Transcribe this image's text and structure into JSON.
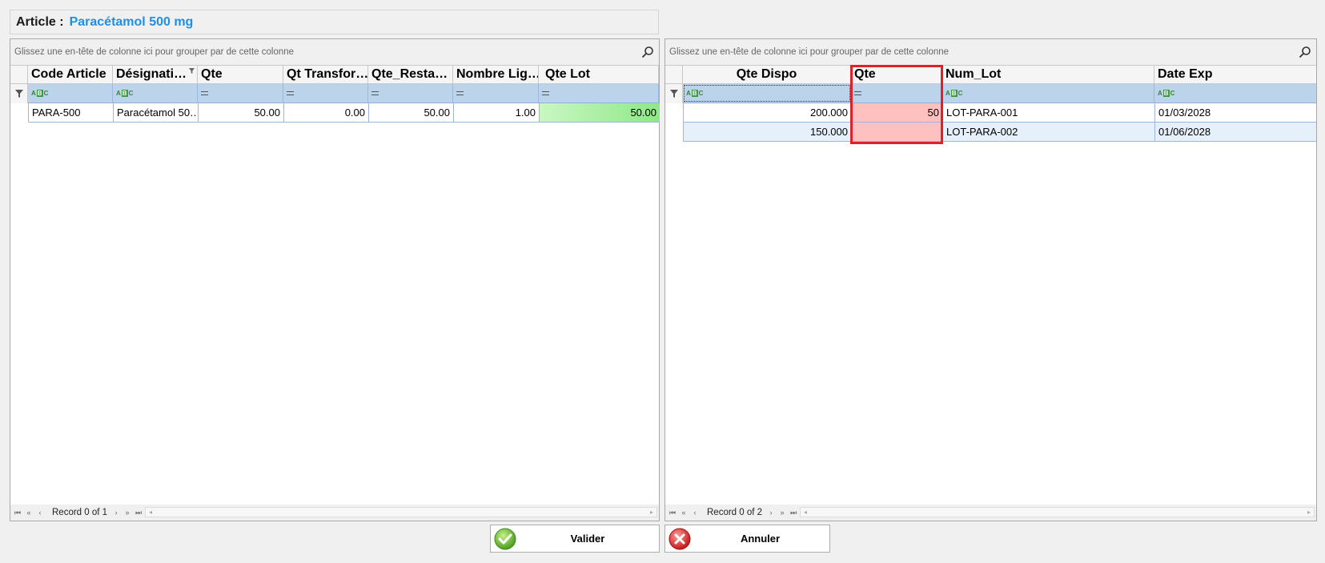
{
  "article": {
    "label": "Article :",
    "value": "Paracétamol 500 mg"
  },
  "group_hint": "Glissez une en-tête de colonne ici pour grouper par de cette colonne",
  "left_grid": {
    "columns": [
      "Code Article",
      "Désignati…",
      "Qte",
      "Qt Transfor…",
      "Qte_Resta…",
      "Nombre Lig…",
      "Qte Lot"
    ],
    "rows": [
      {
        "code": "PARA-500",
        "designation": "Paracétamol 50…",
        "qte": "50.00",
        "qt_transfor": "0.00",
        "qte_resta": "50.00",
        "nombre_lig": "1.00",
        "qte_lot": "50.00"
      }
    ],
    "record_text": "Record 0 of 1"
  },
  "right_grid": {
    "columns": [
      "Qte Dispo",
      "Qte",
      "Num_Lot",
      "Date Exp"
    ],
    "rows": [
      {
        "qte_dispo": "200.000",
        "qte": "50",
        "num_lot": "LOT-PARA-001",
        "date_exp": "01/03/2028"
      },
      {
        "qte_dispo": "150.000",
        "qte": "",
        "num_lot": "LOT-PARA-002",
        "date_exp": "01/06/2028"
      }
    ],
    "record_text": "Record 0 of 2"
  },
  "buttons": {
    "validate": "Valider",
    "cancel": "Annuler"
  },
  "colors": {
    "accent": "#1f8fe6",
    "highlight_green": "#a8f0a0",
    "error_red": "#ffc0c0",
    "error_border": "#e0202a",
    "filter_row": "#bcd3ec"
  }
}
